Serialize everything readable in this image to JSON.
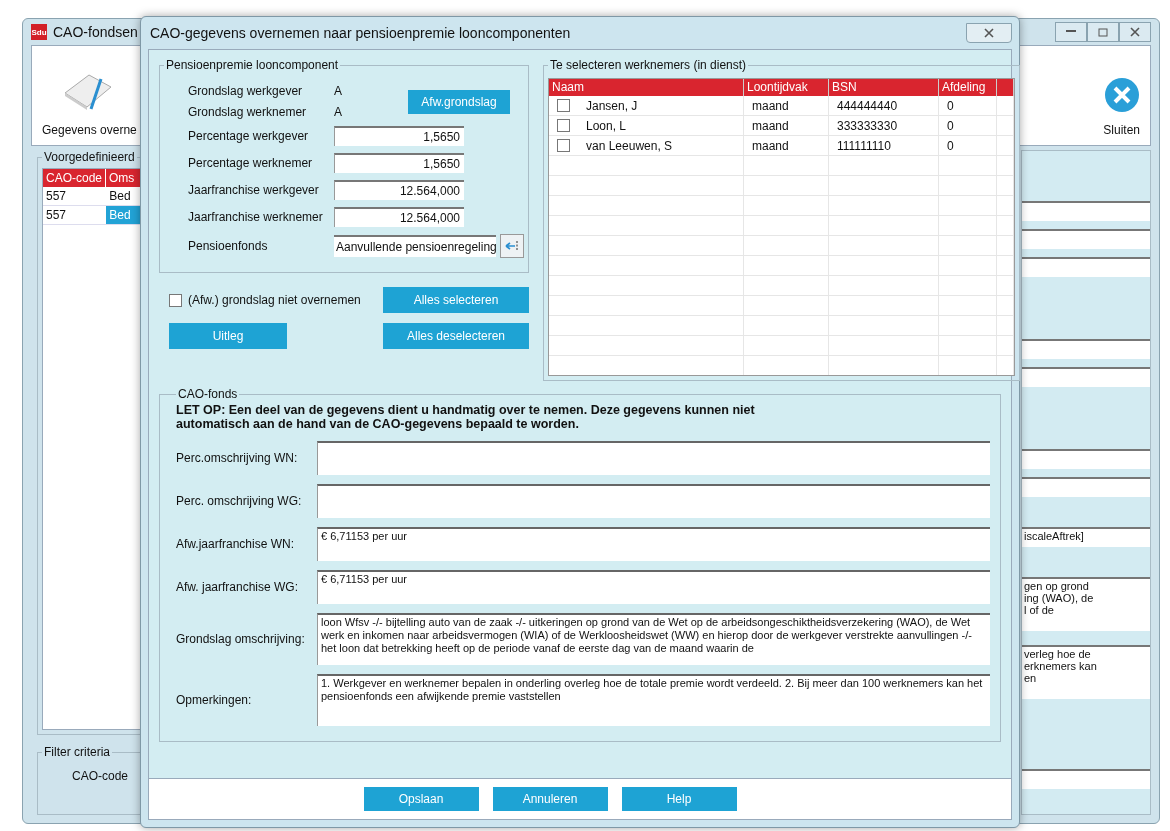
{
  "background_window": {
    "logo_text": "Sdu",
    "title": "CAO-fondsen",
    "toolbar": [
      {
        "label": "Gegevens overne",
        "kind": "document"
      },
      {
        "label": "Sluiten",
        "kind": "close"
      }
    ],
    "group_title": "Voorgedefinieerd",
    "table": {
      "columns": [
        "CAO-code",
        "Oms"
      ],
      "rows": [
        {
          "cells": [
            "557",
            "Bed"
          ],
          "selected": false
        },
        {
          "cells": [
            "557",
            "Bed"
          ],
          "selected": true
        }
      ]
    },
    "filter": {
      "title": "Filter criteria",
      "label": "CAO-code"
    },
    "right_fields": [
      {
        "kind": "input"
      },
      {
        "kind": "input"
      },
      {
        "kind": "input"
      },
      {
        "kind": "input"
      },
      {
        "kind": "input"
      },
      {
        "kind": "input"
      },
      {
        "kind": "input"
      },
      {
        "kind": "input",
        "value": "iscaleAftrek]"
      },
      {
        "kind": "memo",
        "value": "gen op grond\ning (WAO), de\nl of de"
      },
      {
        "kind": "memo",
        "value": "verleg hoe de\nerknemers kan\nen"
      },
      {
        "kind": "input"
      }
    ]
  },
  "dialog": {
    "title": "CAO-gegevens overnemen naar pensioenpremie looncomponenten",
    "pension_group": {
      "title": "Pensioenpremie looncomponent",
      "basis": [
        {
          "label": "Grondslag werkgever",
          "value": "A"
        },
        {
          "label": "Grondslag werknemer",
          "value": "A"
        }
      ],
      "basis_button": "Afw.grondslag",
      "fields": [
        {
          "label": "Percentage werkgever",
          "value": "1,5650"
        },
        {
          "label": "Percentage werknemer",
          "value": "1,5650"
        },
        {
          "label": "Jaarfranchise werkgever",
          "value": "12.564,000"
        },
        {
          "label": "Jaarfranchise werknemer",
          "value": "12.564,000"
        }
      ],
      "fund": {
        "label": "Pensioenfonds",
        "value": "Aanvullende pensioenregeling"
      }
    },
    "skip_basis": {
      "label": "(Afw.) grondslag niet overnemen",
      "checked": false
    },
    "select_all": "Alles selecteren",
    "explain": "Uitleg",
    "deselect_all": "Alles deselecteren",
    "employees": {
      "title": "Te selecteren werknemers (in dienst)",
      "columns": [
        "Naam",
        "Loontijdvak",
        "BSN",
        "Afdeling"
      ],
      "rows": [
        {
          "checked": false,
          "cells": [
            "Jansen, J",
            "maand",
            "444444440",
            "0"
          ]
        },
        {
          "checked": false,
          "cells": [
            "Loon, L",
            "maand",
            "333333330",
            "0"
          ]
        },
        {
          "checked": false,
          "cells": [
            "van Leeuwen, S",
            "maand",
            "111111110",
            "0"
          ]
        }
      ]
    },
    "cao_fund": {
      "title": "CAO-fonds",
      "notice": "LET OP: Een deel van de gegevens dient u handmatig over te nemen. Deze gegevens kunnen niet automatisch aan de hand van de CAO-gegevens bepaald te worden.",
      "fields": [
        {
          "label": "Perc.omschrijving WN:",
          "kind": "short"
        },
        {
          "label": "Perc. omschrijving WG:",
          "kind": "short"
        },
        {
          "label": "Afw.jaarfranchise WN:",
          "kind": "short",
          "value": "€ 6,71153 per uur"
        },
        {
          "label": "Afw. jaarfranchise WG:",
          "kind": "short",
          "value": "€ 6,71153 per uur"
        },
        {
          "label": "Grondslag omschrijving:",
          "kind": "long",
          "value": "loon Wfsv -/- bijtelling auto van de zaak -/- uitkeringen op grond van de Wet op de arbeidsongeschiktheidsverzekering (WAO), de Wet werk en inkomen naar arbeidsvermogen (WIA) of de Werkloosheidswet (WW) en hierop door de werkgever verstrekte aanvullingen -/- het loon dat betrekking heeft op de periode vanaf de eerste dag van de maand waarin de"
        },
        {
          "label": "Opmerkingen:",
          "kind": "long",
          "value": "1. Werkgever en werknemer bepalen in onderling overleg hoe de totale premie wordt verdeeld. 2. Bij meer dan 100 werknemers kan het pensioenfonds een afwijkende premie vaststellen"
        }
      ]
    },
    "footer_buttons": [
      "Opslaan",
      "Annuleren",
      "Help"
    ]
  }
}
